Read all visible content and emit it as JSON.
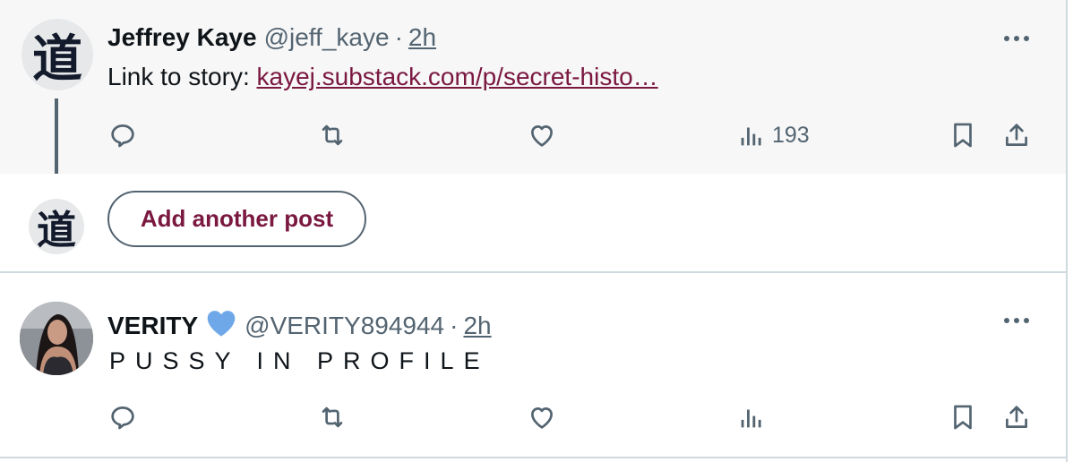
{
  "thread_post": {
    "avatar": {
      "glyph": "道",
      "description": "kanji avatar"
    },
    "author_name": "Jeffrey Kaye",
    "handle": "@jeff_kaye",
    "separator": "·",
    "time": "2h",
    "text_prefix": "Link to story: ",
    "link_text": "kayej.substack.com/p/secret-histo…",
    "actions": {
      "reply_count": "",
      "repost_count": "",
      "like_count": "",
      "views_count": "193"
    }
  },
  "composer": {
    "avatar": {
      "glyph": "道"
    },
    "add_post_label": "Add another post"
  },
  "reply_post": {
    "author_name": "VERITY",
    "verified_badge": "heart",
    "handle": "@VERITY894944",
    "separator": "·",
    "time": "2h",
    "text": "PUSSY IN PROFILE",
    "actions": {
      "reply_count": "",
      "repost_count": "",
      "like_count": "",
      "views_count": ""
    }
  },
  "colors": {
    "link": "#7a1840",
    "icon": "#536471",
    "heart_badge": "#6ea8e8",
    "highlight_bg": "#f7f7f7"
  }
}
